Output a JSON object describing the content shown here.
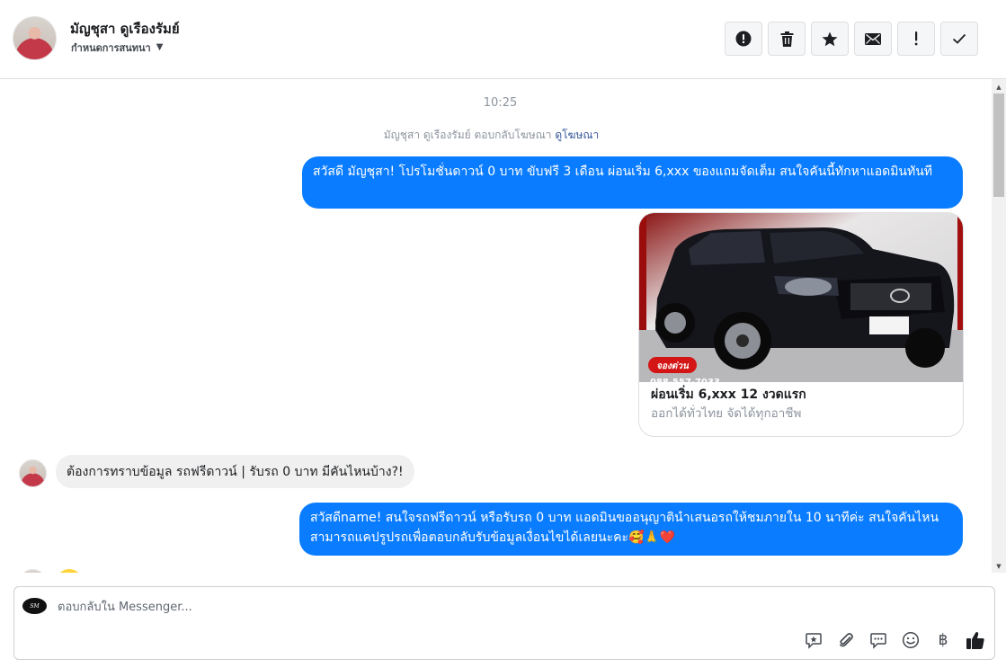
{
  "header": {
    "contact_name": "มัญชุสา ดูเรืองรัมย์",
    "assign_label": "กำหนดการสนทนา",
    "actions": [
      {
        "name": "mark-spam",
        "icon": "alert-circle-icon"
      },
      {
        "name": "delete",
        "icon": "trash-icon"
      },
      {
        "name": "star",
        "icon": "star-icon"
      },
      {
        "name": "mark-unread",
        "icon": "envelope-icon"
      },
      {
        "name": "follow-up",
        "icon": "exclamation-icon"
      },
      {
        "name": "mark-done",
        "icon": "check-icon"
      }
    ]
  },
  "conversation": {
    "timestamp": "10:25",
    "ad_reply_prefix": "มัญชุสา ดูเรืองรัมย์ ตอบกลับโฆษณา",
    "ad_link": "ดูโฆษณา",
    "messages": [
      {
        "from": "page",
        "text": "สวัสดี มัญชุสา! โปรโมชั่นดาวน์ 0 บาท ขับฟรี 3 เดือน ผ่อนเริ่ม 6,xxx ของแถมจัดเต็ม สนใจคันนี้ทักหาแอดมินทันที"
      },
      {
        "from": "customer",
        "text": "ต้องการทราบข้อมูล รถฟรีดาวน์ | รับรถ 0 บาท มีคันไหนบ้าง?!"
      },
      {
        "from": "page",
        "text": "สวัสดีname! สนใจรถฟรีดาวน์ หรือรับรถ 0 บาท แอดมินขออนุญาตินำเสนอรถให้ชมภายใน 10 นาทีค่ะ สนใจคันไหนสามารถแคปรูปรถเพื่อตอบกลับรับข้อมูลเงื่อนไขได้เลยนะคะ🥰🙏❤️"
      }
    ],
    "ad_card": {
      "title": "ผ่อนเริ่ม 6,xxx 12 งวดแรก",
      "subtitle": "ออกได้ทั่วไทย จัดได้ทุกอาชีพ",
      "badge": "จองด่วน",
      "phone_partial": "088-557-7033"
    }
  },
  "composer": {
    "placeholder": "ตอบกลับใน Messenger...",
    "page_logo_text": "SM",
    "tools": [
      "saved-reply-icon",
      "paperclip-icon",
      "chat-bubble-icon",
      "smiley-icon",
      "baht-icon",
      "thumbs-up-icon"
    ],
    "baht_symbol": "฿"
  },
  "colors": {
    "outgoing_bubble": "#0a7cff",
    "incoming_bubble": "#f0f0f0",
    "link": "#365899"
  }
}
